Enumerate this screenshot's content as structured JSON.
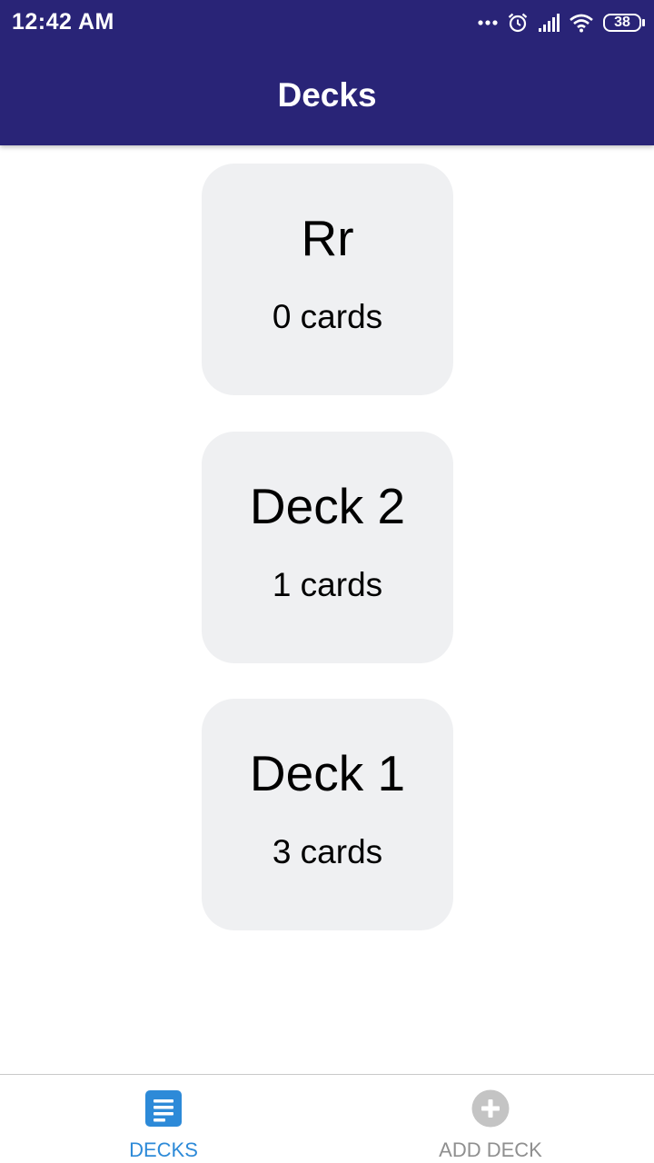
{
  "status_bar": {
    "time": "12:42 AM",
    "battery": "38"
  },
  "header": {
    "title": "Decks"
  },
  "decks": [
    {
      "name": "Rr",
      "count": "0 cards"
    },
    {
      "name": "Deck 2",
      "count": "1 cards"
    },
    {
      "name": "Deck 1",
      "count": "3 cards"
    }
  ],
  "bottom_nav": {
    "items": [
      {
        "label": "DECKS",
        "icon": "list-icon",
        "active": true
      },
      {
        "label": "ADD DECK",
        "icon": "add-circle-icon",
        "active": false
      }
    ]
  },
  "colors": {
    "header": "#292477",
    "card": "#eff0f2",
    "active": "#2d8ad8",
    "inactive": "#8f8f8f"
  }
}
